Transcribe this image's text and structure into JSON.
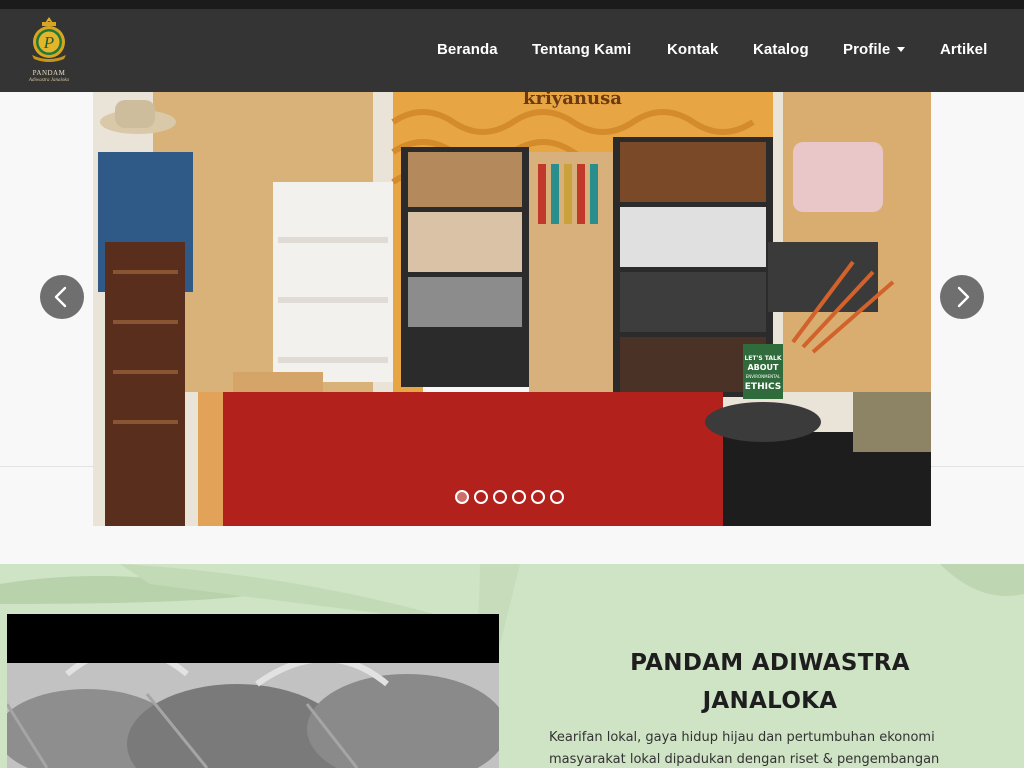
{
  "brand": {
    "logo_line1": "PANDAM",
    "logo_line2": "Adiwastra Janaloka",
    "logo_letter": "P",
    "colors": {
      "gold": "#d9a520",
      "green": "#1f7a3a"
    }
  },
  "nav": {
    "items": [
      {
        "label": "Beranda"
      },
      {
        "label": "Tentang Kami"
      },
      {
        "label": "Kontak"
      },
      {
        "label": "Katalog"
      },
      {
        "label": "Profile",
        "has_dropdown": true
      },
      {
        "label": "Artikel"
      }
    ]
  },
  "carousel": {
    "slide_count": 6,
    "active_index": 0,
    "prev_icon": "chevron-left-icon",
    "next_icon": "chevron-right-icon",
    "slide_sign": {
      "line1": "LET'S TALK",
      "line2": "ABOUT",
      "line3": "ENVIRONMENTAL",
      "line4": "ETHICS"
    },
    "store_header": "kriyanusa"
  },
  "about": {
    "title_line1": "PANDAM ADIWASTRA",
    "title_line2": "JANALOKA",
    "text": "Kearifan lokal, gaya hidup hijau dan pertumbuhan ekonomi masyarakat lokal dipadukan dengan riset & pengembangan"
  }
}
